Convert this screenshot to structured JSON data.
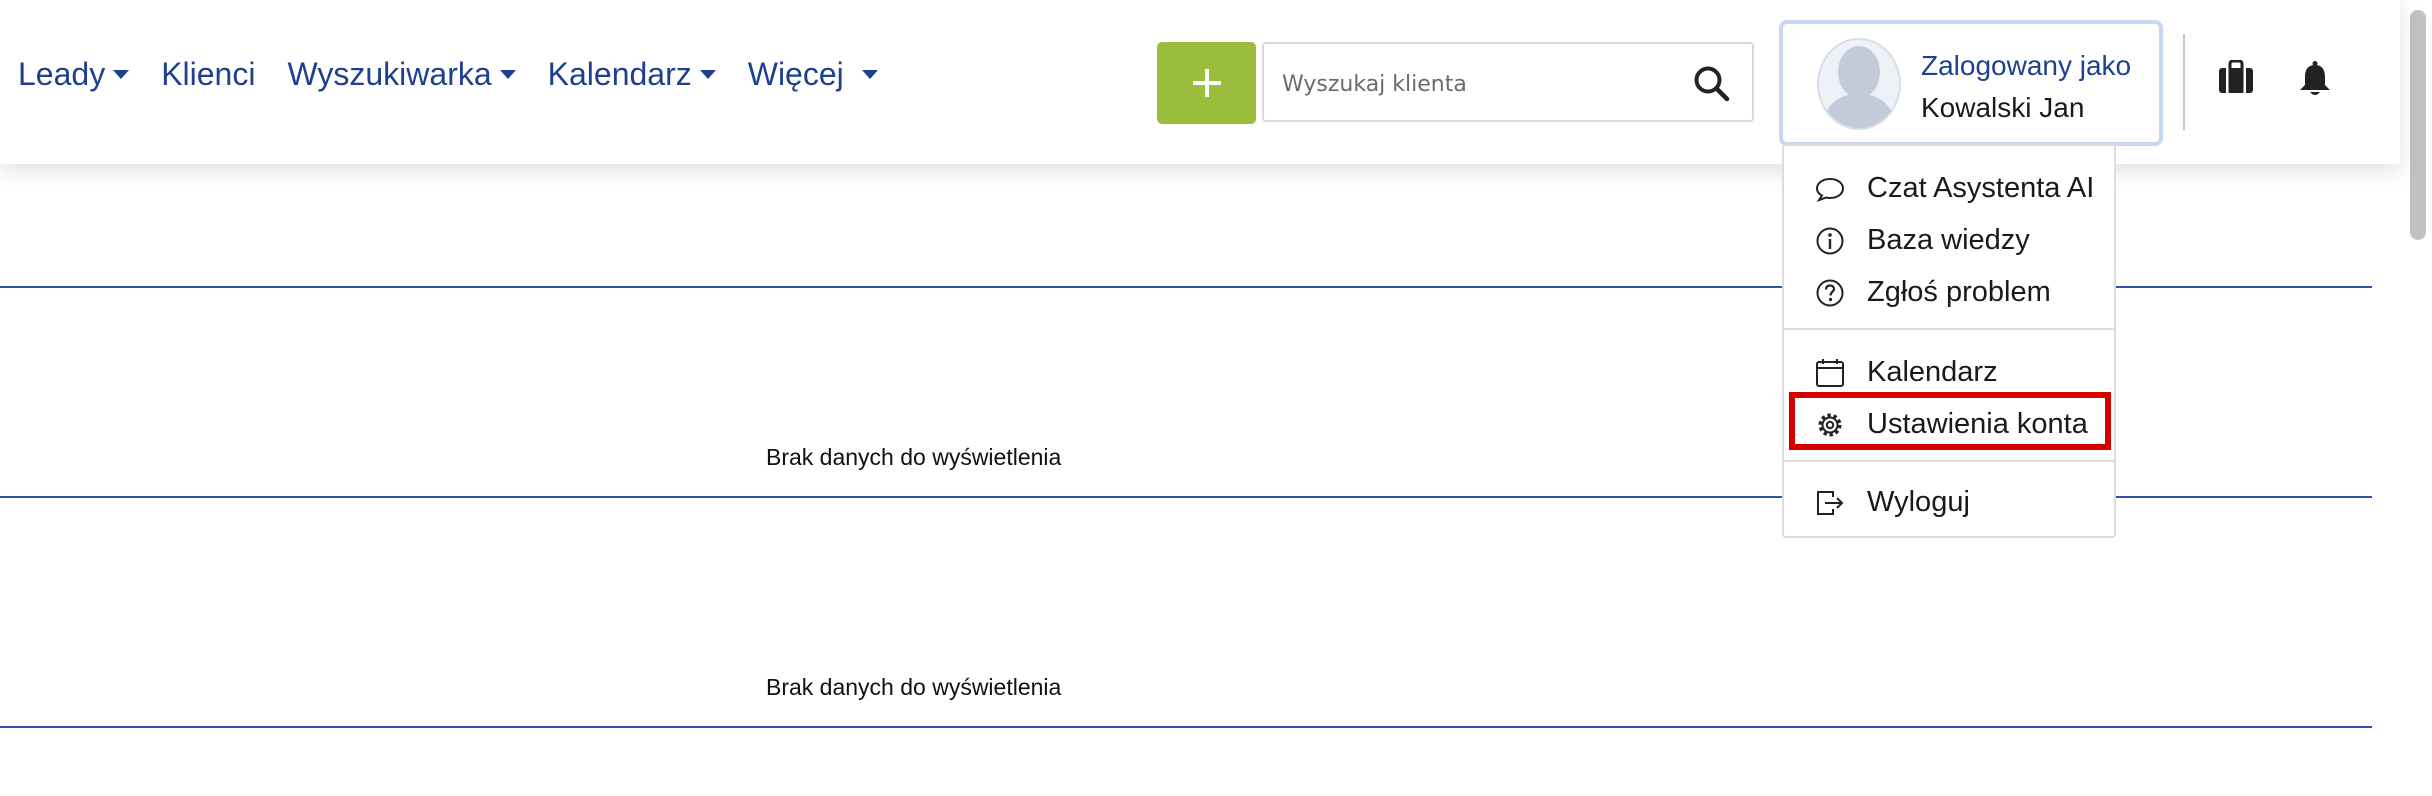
{
  "nav": {
    "items": [
      {
        "label": "Leady",
        "has_caret": true
      },
      {
        "label": "Klienci",
        "has_caret": false
      },
      {
        "label": "Wyszukiwarka",
        "has_caret": true
      },
      {
        "label": "Kalendarz",
        "has_caret": true
      },
      {
        "label": "Więcej",
        "has_caret": true
      }
    ]
  },
  "header": {
    "add_button_label": "+",
    "search": {
      "placeholder": "Wyszukaj klienta",
      "value": ""
    },
    "user": {
      "logged_in_as": "Zalogowany jako",
      "name": "Kowalski Jan"
    }
  },
  "content": {
    "empty_messages": [
      "Brak danych do wyświetlenia",
      "Brak danych do wyświetlenia"
    ]
  },
  "dropdown": {
    "items": [
      {
        "label": "Czat Asystenta AI",
        "icon": "chat-bubble-icon"
      },
      {
        "label": "Baza wiedzy",
        "icon": "info-circle-icon"
      },
      {
        "label": "Zgłoś problem",
        "icon": "question-circle-icon"
      },
      {
        "label": "Kalendarz",
        "icon": "calendar-icon"
      },
      {
        "label": "Ustawienia konta",
        "icon": "gear-icon",
        "highlighted": true
      },
      {
        "label": "Wyloguj",
        "icon": "logout-icon"
      }
    ]
  },
  "colors": {
    "nav_text": "#1f3f8f",
    "add_button": "#9bbd3c",
    "divider_line": "#2c55a8",
    "highlight": "#d40000"
  }
}
